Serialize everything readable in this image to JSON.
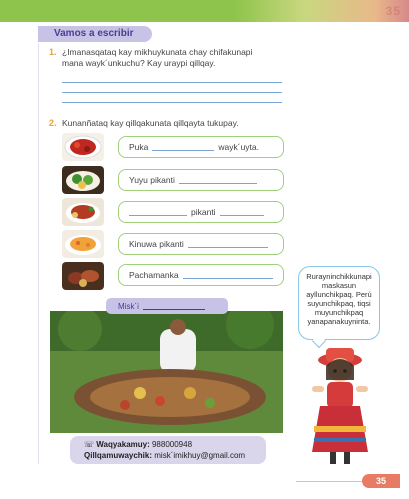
{
  "header": {
    "corner_page_mark": "35"
  },
  "section": {
    "tab_label": "Vamos a escribir"
  },
  "question1": {
    "number": "1.",
    "line1": "¿Imanasqataq kay mikhuykunata chay chifakunapi",
    "line2": "mana wayk´unkuchu? Kay uraypi qillqay."
  },
  "question2": {
    "number": "2.",
    "text": "Kunanñataq kay qillqakunata qillqayta tukupay."
  },
  "exercises": [
    {
      "before": "Puka",
      "after": "wayk´uyta."
    },
    {
      "before": "Yuyu pikanti",
      "after": ""
    },
    {
      "before": "",
      "after": "pikanti"
    },
    {
      "before": "Kinuwa pikanti",
      "after": ""
    },
    {
      "before": "Pachamanka",
      "after": ""
    }
  ],
  "photo_caption": {
    "label": "Misk´i"
  },
  "speech_bubble": {
    "line1": "Rurayninchikkunapi",
    "line2": "maskasun",
    "line3": "ayllunchikpaq. Perú",
    "line4": "suyunchikpaq, tiqsi",
    "line5": "muyunchikpaq",
    "line6": "yanapanakuyninta."
  },
  "contact": {
    "phone_label": "Waqyakamuy:",
    "phone_value": "988000948",
    "email_label": "Qillqamuwaychik:",
    "email_value": "misk´imikhuy@gmail.com"
  },
  "footer": {
    "page_number": "35"
  },
  "colors": {
    "green": "#8fc44c",
    "lavender": "#c7c3e6",
    "orange": "#e77b63",
    "blue_line": "#7aa6d6"
  }
}
